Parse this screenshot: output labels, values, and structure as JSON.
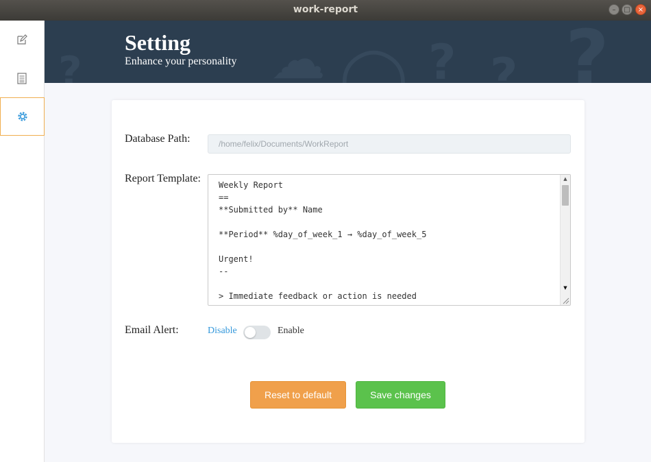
{
  "window": {
    "title": "work-report",
    "controls": {
      "minimize": "–",
      "maximize": "□",
      "close": "×"
    }
  },
  "sidebar": {
    "items": [
      {
        "icon": "edit-icon",
        "active": false
      },
      {
        "icon": "document-list-icon",
        "active": false
      },
      {
        "icon": "settings-icon",
        "active": true
      }
    ],
    "active_color": "#f0ad4e",
    "icon_active_color": "#3498db"
  },
  "header": {
    "title": "Setting",
    "subtitle": "Enhance your personality"
  },
  "form": {
    "database_path": {
      "label": "Database Path:",
      "value": "/home/felix/Documents/WorkReport"
    },
    "report_template": {
      "label": "Report Template:",
      "lines": [
        "Weekly Report",
        "==",
        "**Submitted by** Name",
        "",
        "**Period** %day_of_week_1 → %day_of_week_5",
        "",
        "Urgent!",
        "--",
        "",
        "> Immediate feedback or action is needed"
      ]
    },
    "email_alert": {
      "label": "Email Alert:",
      "off_label": "Disable",
      "on_label": "Enable",
      "enabled": false
    }
  },
  "actions": {
    "reset_label": "Reset to default",
    "save_label": "Save changes"
  },
  "colors": {
    "header_bg": "#2c3e50",
    "reset": "#f0a04b",
    "save": "#5bc24c",
    "link": "#3498db"
  }
}
